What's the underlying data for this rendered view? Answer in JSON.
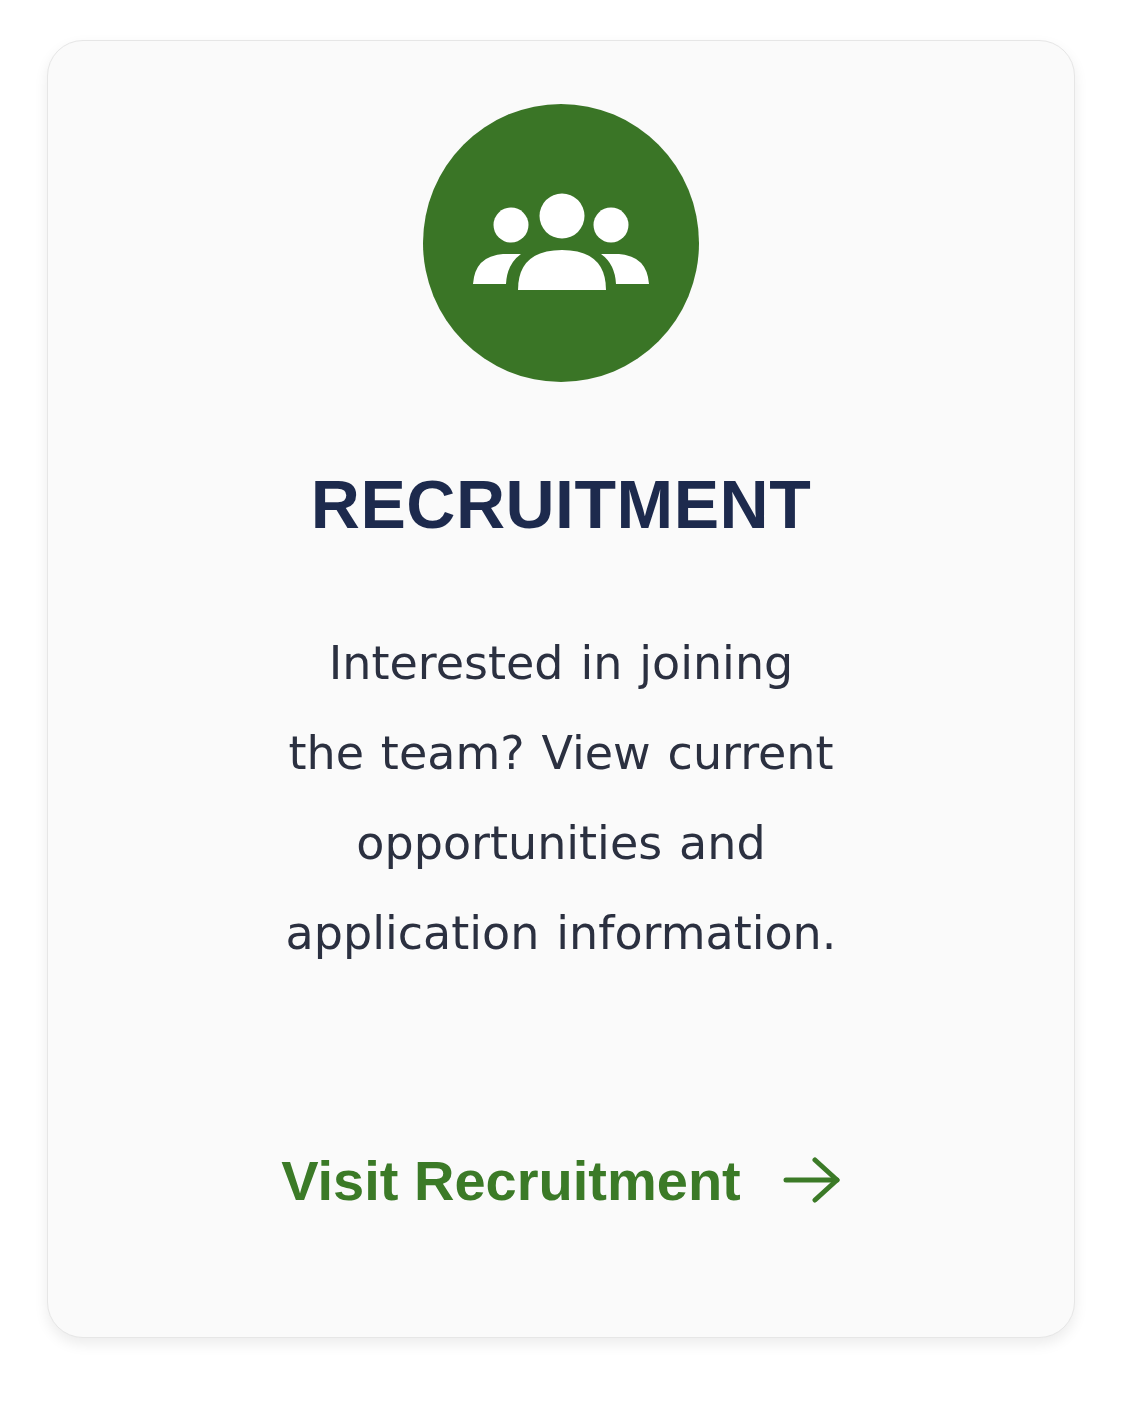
{
  "card": {
    "title": "RECRUITMENT",
    "description": "Interested in joining the team? View current opportunities and application information.",
    "link": {
      "label": "Visit Recruitment"
    }
  }
}
